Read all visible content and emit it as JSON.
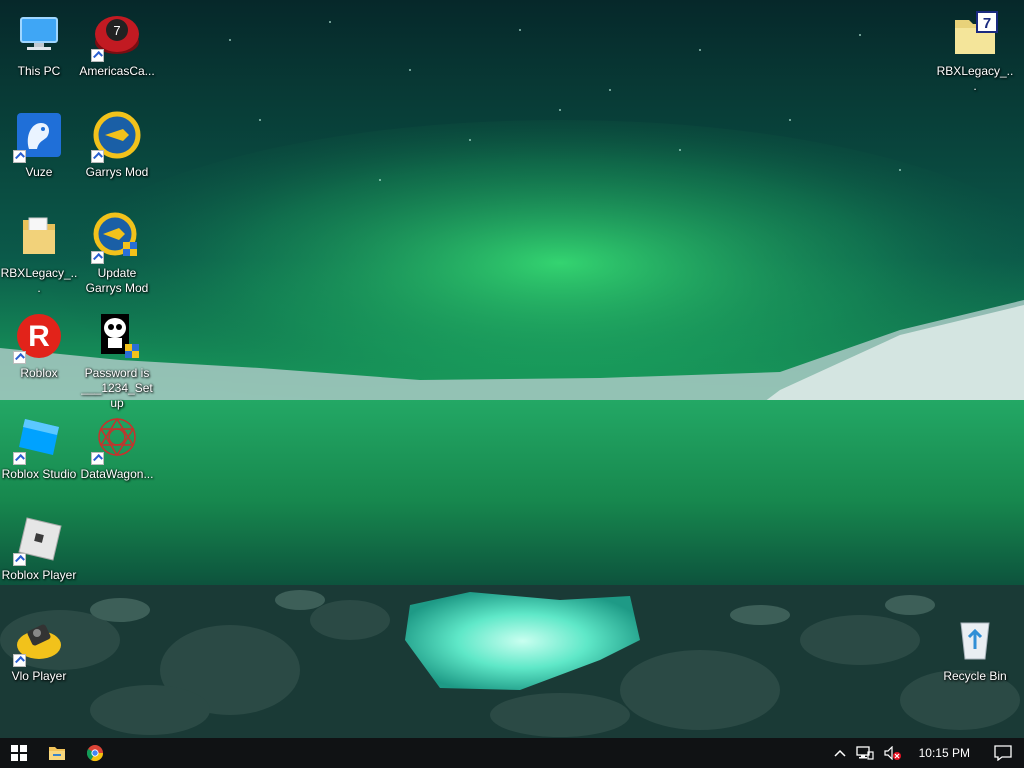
{
  "desktop": {
    "icons": [
      {
        "label": "This PC",
        "icon": "computer-icon",
        "shortcut": false
      },
      {
        "label": "AmericasCa...",
        "icon": "casino-chip-icon",
        "shortcut": true
      },
      {
        "label": "Vuze",
        "icon": "frog-icon",
        "shortcut": true
      },
      {
        "label": "Garrys Mod",
        "icon": "gmod-icon",
        "shortcut": true
      },
      {
        "label": "RBXLegacy_...",
        "icon": "folder-icon",
        "shortcut": false
      },
      {
        "label": "Update Garrys Mod",
        "icon": "gmod-update-icon",
        "shortcut": true
      },
      {
        "label": "Roblox",
        "icon": "roblox-icon",
        "shortcut": true
      },
      {
        "label": "Password is ___1234_Setup",
        "icon": "skull-setup-icon",
        "shortcut": false
      },
      {
        "label": "Roblox Studio",
        "icon": "roblox-studio-icon",
        "shortcut": true
      },
      {
        "label": "DataWagon...",
        "icon": "datawagon-icon",
        "shortcut": true
      },
      {
        "label": "Roblox Player",
        "icon": "roblox-player-icon",
        "shortcut": true
      },
      {
        "label": "Vlo Player",
        "icon": "vlo-player-icon",
        "shortcut": true
      },
      {
        "label": "RBXLegacy_...",
        "icon": "winrar-archive-icon",
        "shortcut": false
      },
      {
        "label": "Recycle Bin",
        "icon": "recycle-bin-icon",
        "shortcut": false
      }
    ]
  },
  "taskbar": {
    "start": "windows-logo-icon",
    "pinned": [
      "file-explorer-icon",
      "chrome-icon"
    ],
    "tray": {
      "chevron": "chevron-up-icon",
      "network": "network-icon",
      "volume": "volume-muted-icon",
      "clock": "10:15 PM",
      "action_center": "notification-icon"
    }
  }
}
